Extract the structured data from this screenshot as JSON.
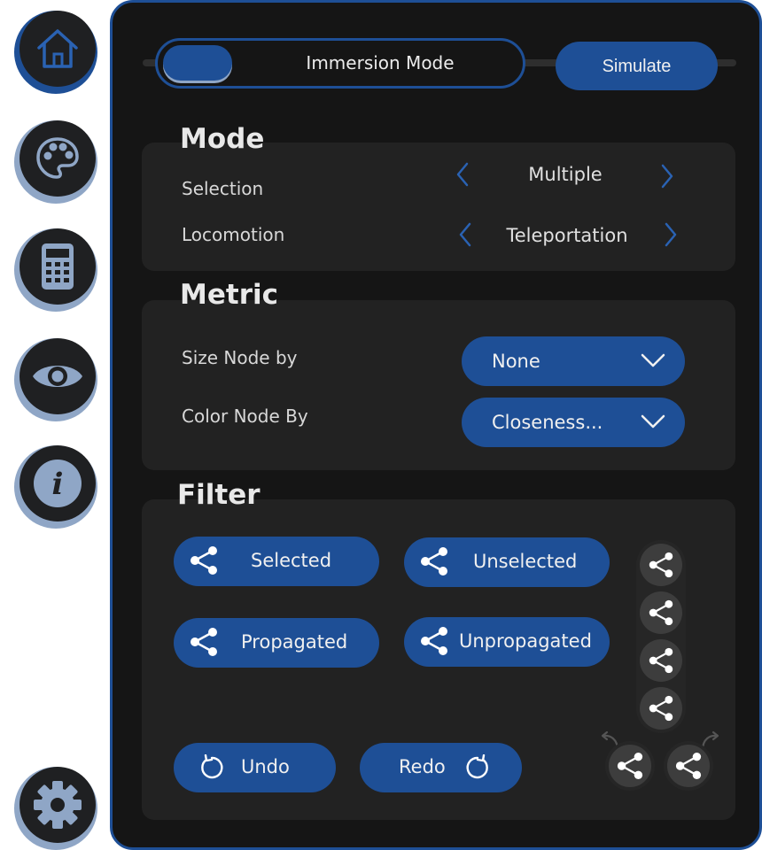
{
  "rail": {
    "items": [
      {
        "icon": "home-icon",
        "active": true
      },
      {
        "icon": "palette-icon",
        "active": false
      },
      {
        "icon": "calculator-icon",
        "active": false
      },
      {
        "icon": "eye-icon",
        "active": false
      },
      {
        "icon": "info-icon",
        "active": false
      },
      {
        "icon": "gear-icon",
        "active": false
      }
    ]
  },
  "topbar": {
    "immersion_label": "Immersion Mode",
    "simulate_label": "Simulate"
  },
  "mode": {
    "title": "Mode",
    "selection_label": "Selection",
    "selection_value": "Multiple",
    "locomotion_label": "Locomotion",
    "locomotion_value": "Teleportation"
  },
  "metric": {
    "title": "Metric",
    "size_label": "Size Node by",
    "size_value": "None",
    "color_label": "Color Node By",
    "color_value": "Closeness..."
  },
  "filter": {
    "title": "Filter",
    "selected": "Selected",
    "unselected": "Unselected",
    "propagated": "Propagated",
    "unpropagated": "Unpropagated",
    "undo": "Undo",
    "redo": "Redo"
  },
  "colors": {
    "accent": "#1e4f96",
    "panel": "#151515",
    "card": "#222222",
    "rail_shadow": "#8fa6c6"
  }
}
